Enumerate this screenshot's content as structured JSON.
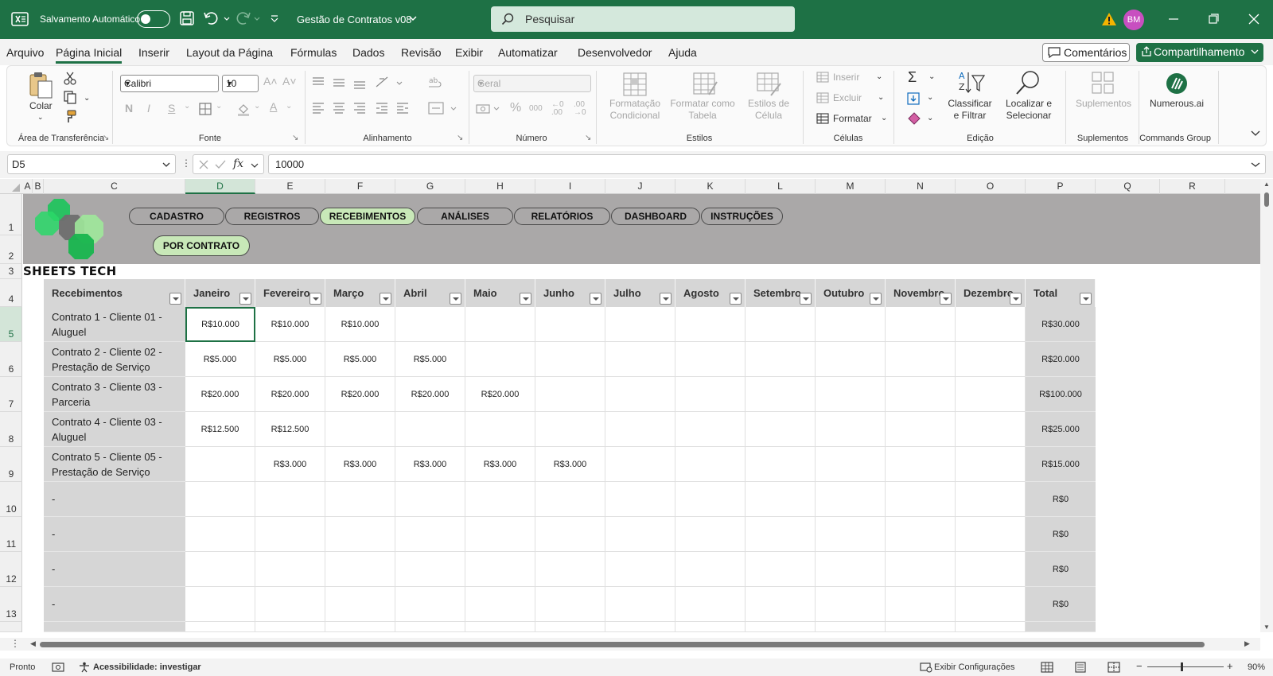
{
  "titlebar": {
    "autosave_label": "Salvamento Automático",
    "doc_title": "Gestão de Contratos v08",
    "search_placeholder": "Pesquisar",
    "avatar_initials": "BM"
  },
  "menu": {
    "tabs": [
      "Arquivo",
      "Página Inicial",
      "Inserir",
      "Layout da Página",
      "Fórmulas",
      "Dados",
      "Revisão",
      "Exibir",
      "Automatizar",
      "Desenvolvedor",
      "Ajuda"
    ],
    "active_tab": "Página Inicial",
    "comments_label": "Comentários",
    "share_label": "Compartilhamento"
  },
  "ribbon": {
    "clipboard": {
      "paste_label": "Colar",
      "group_label": "Área de Transferência"
    },
    "font": {
      "font_name": "Calibri",
      "font_size": "10",
      "group_label": "Fonte",
      "bold": "N",
      "italic": "I",
      "underline": "S"
    },
    "alignment": {
      "group_label": "Alinhamento"
    },
    "number": {
      "format": "Geral",
      "percent": "%",
      "thousands": "000",
      "group_label": "Número"
    },
    "styles": {
      "conditional": "Formatação Condicional",
      "as_table": "Formatar como Tabela",
      "cell_styles": "Estilos de Célula",
      "group_label": "Estilos"
    },
    "cells": {
      "insert": "Inserir",
      "delete": "Excluir",
      "format": "Formatar",
      "group_label": "Células"
    },
    "editing": {
      "sort_filter": "Classificar e Filtrar",
      "find_select": "Localizar e Selecionar",
      "group_label": "Edição"
    },
    "addins": {
      "label": "Suplementos",
      "group_label": "Suplementos"
    },
    "commands": {
      "label": "Numerous.ai",
      "group_label": "Commands Group"
    }
  },
  "formula_bar": {
    "name_box": "D5",
    "formula": "10000",
    "fx": "fx"
  },
  "grid": {
    "columns": [
      "A",
      "B",
      "C",
      "D",
      "E",
      "F",
      "G",
      "H",
      "I",
      "J",
      "K",
      "L",
      "M",
      "N",
      "O",
      "P",
      "Q",
      "R"
    ],
    "selected_column": "D",
    "rows": [
      "1",
      "2",
      "3",
      "4",
      "5",
      "6",
      "7",
      "8",
      "9",
      "10",
      "11",
      "12",
      "13"
    ],
    "selected_row": "5"
  },
  "nav": {
    "buttons": [
      "CADASTRO",
      "REGISTROS",
      "RECEBIMENTOS",
      "ANÁLISES",
      "RELATÓRIOS",
      "DASHBOARD",
      "INSTRUÇÕES"
    ],
    "active": "RECEBIMENTOS",
    "sub_button": "POR CONTRATO",
    "brand": "SHEETS TECH"
  },
  "table": {
    "headers": [
      "Recebimentos",
      "Janeiro",
      "Fevereiro",
      "Março",
      "Abril",
      "Maio",
      "Junho",
      "Julho",
      "Agosto",
      "Setembro",
      "Outubro",
      "Novembro",
      "Dezembro",
      "Total"
    ],
    "rows": [
      {
        "label": "Contrato 1 - Cliente 01 - Aluguel",
        "values": [
          "R$10.000",
          "R$10.000",
          "R$10.000",
          "",
          "",
          "",
          "",
          "",
          "",
          "",
          "",
          ""
        ],
        "total": "R$30.000"
      },
      {
        "label": "Contrato 2 - Cliente 02 - Prestação de Serviço",
        "values": [
          "R$5.000",
          "R$5.000",
          "R$5.000",
          "R$5.000",
          "",
          "",
          "",
          "",
          "",
          "",
          "",
          ""
        ],
        "total": "R$20.000"
      },
      {
        "label": "Contrato 3 - Cliente 03 - Parceria",
        "values": [
          "R$20.000",
          "R$20.000",
          "R$20.000",
          "R$20.000",
          "R$20.000",
          "",
          "",
          "",
          "",
          "",
          "",
          ""
        ],
        "total": "R$100.000"
      },
      {
        "label": "Contrato 4 - Cliente 03 - Aluguel",
        "values": [
          "R$12.500",
          "R$12.500",
          "",
          "",
          "",
          "",
          "",
          "",
          "",
          "",
          "",
          ""
        ],
        "total": "R$25.000"
      },
      {
        "label": "Contrato 5 - Cliente 05 - Prestação de Serviço",
        "values": [
          "",
          "R$3.000",
          "R$3.000",
          "R$3.000",
          "R$3.000",
          "R$3.000",
          "",
          "",
          "",
          "",
          "",
          ""
        ],
        "total": "R$15.000"
      },
      {
        "label": "-",
        "values": [
          "",
          "",
          "",
          "",
          "",
          "",
          "",
          "",
          "",
          "",
          "",
          ""
        ],
        "total": "R$0"
      },
      {
        "label": "-",
        "values": [
          "",
          "",
          "",
          "",
          "",
          "",
          "",
          "",
          "",
          "",
          "",
          ""
        ],
        "total": "R$0"
      },
      {
        "label": "-",
        "values": [
          "",
          "",
          "",
          "",
          "",
          "",
          "",
          "",
          "",
          "",
          "",
          ""
        ],
        "total": "R$0"
      },
      {
        "label": "-",
        "values": [
          "",
          "",
          "",
          "",
          "",
          "",
          "",
          "",
          "",
          "",
          "",
          ""
        ],
        "total": "R$0"
      }
    ]
  },
  "status": {
    "ready": "Pronto",
    "accessibility": "Acessibilidade: investigar",
    "display_settings": "Exibir Configurações",
    "zoom": "90%"
  },
  "colors": {
    "excel_green": "#1e7145",
    "banner_gray": "#aaa8a8",
    "header_gray": "#d6d6d6",
    "active_nav": "#c8e8b8"
  }
}
